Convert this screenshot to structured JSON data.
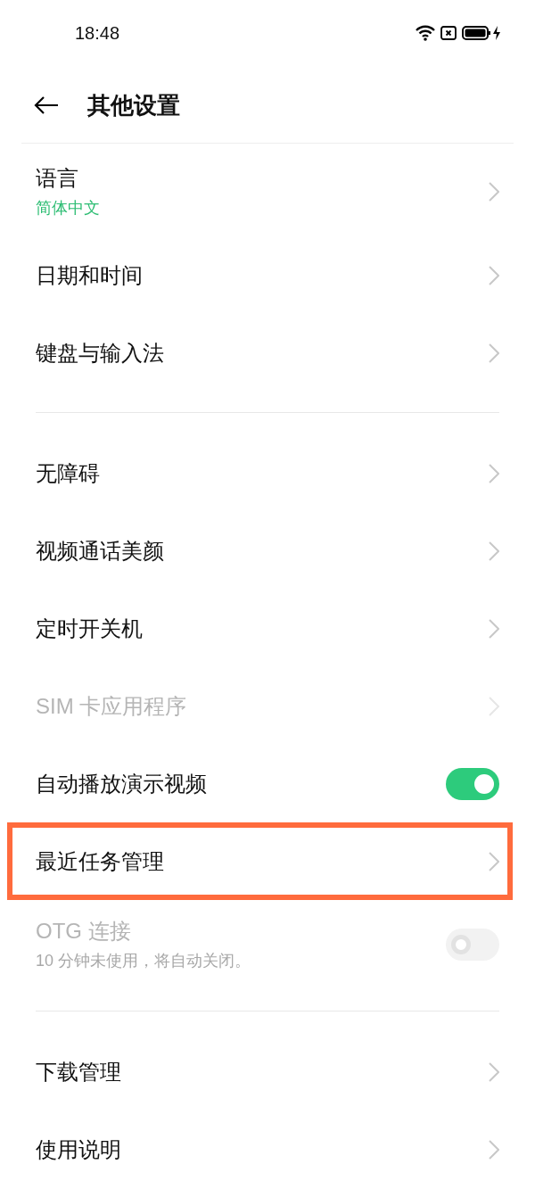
{
  "status_bar": {
    "time": "18:48"
  },
  "header": {
    "title": "其他设置"
  },
  "groups": [
    {
      "items": [
        {
          "kind": "link",
          "label": "语言",
          "subtitle": "简体中文",
          "disabled": false,
          "highlighted": false
        },
        {
          "kind": "link",
          "label": "日期和时间",
          "disabled": false,
          "highlighted": false
        },
        {
          "kind": "link",
          "label": "键盘与输入法",
          "disabled": false,
          "highlighted": false
        }
      ]
    },
    {
      "items": [
        {
          "kind": "link",
          "label": "无障碍",
          "disabled": false,
          "highlighted": false
        },
        {
          "kind": "link",
          "label": "视频通话美颜",
          "disabled": false,
          "highlighted": false
        },
        {
          "kind": "link",
          "label": "定时开关机",
          "disabled": false,
          "highlighted": false
        },
        {
          "kind": "link",
          "label": "SIM 卡应用程序",
          "disabled": true,
          "highlighted": false
        },
        {
          "kind": "switch",
          "label": "自动播放演示视频",
          "on": true,
          "disabled": false,
          "highlighted": false
        },
        {
          "kind": "link",
          "label": "最近任务管理",
          "disabled": false,
          "highlighted": true
        },
        {
          "kind": "switch",
          "label": "OTG 连接",
          "subtitle": "10 分钟未使用，将自动关闭。",
          "on": false,
          "disabled": true,
          "highlighted": false
        }
      ]
    },
    {
      "items": [
        {
          "kind": "link",
          "label": "下载管理",
          "disabled": false,
          "highlighted": false
        },
        {
          "kind": "link",
          "label": "使用说明",
          "disabled": false,
          "highlighted": false
        }
      ]
    }
  ]
}
